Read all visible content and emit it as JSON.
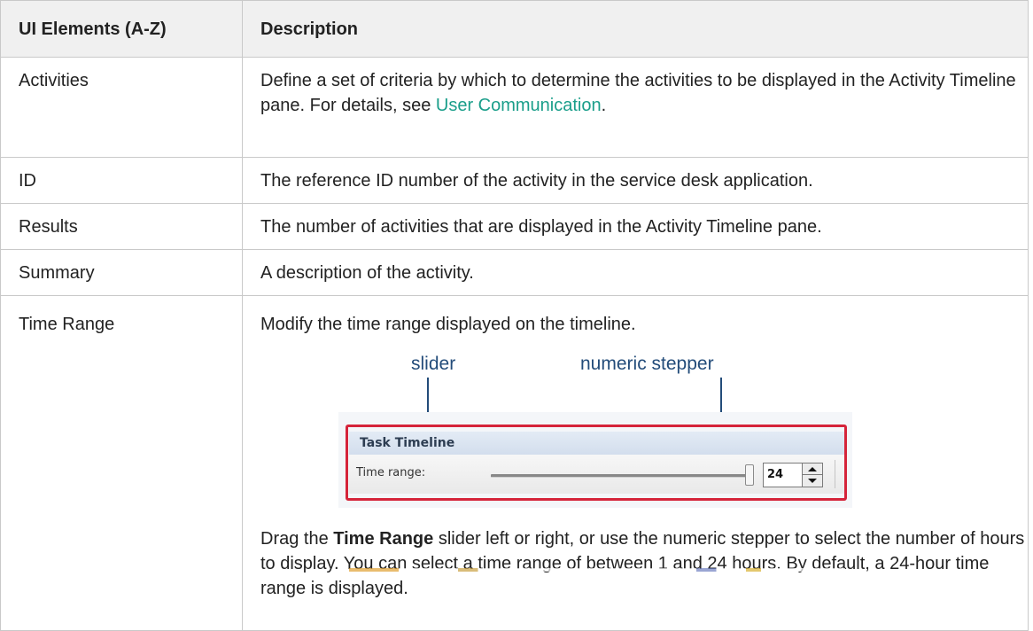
{
  "table": {
    "header": {
      "col1": "UI Elements (A-Z)",
      "col2": "Description"
    },
    "rows": [
      {
        "name": "Activities",
        "desc_before_link": "Define a set of criteria by which to determine the activities to be displayed in the Activity Timeline pane. For details, see ",
        "link": "User Communication",
        "desc_after_link": "."
      },
      {
        "name": "ID",
        "desc": "The reference ID number of the activity in the service desk application."
      },
      {
        "name": "Results",
        "desc": "The number of activities that are displayed in the Activity Timeline pane."
      },
      {
        "name": "Summary",
        "desc": "A description of the activity."
      },
      {
        "name": "Time Range",
        "desc": "Modify the time range displayed on the timeline.",
        "figure": {
          "callout_slider": "slider",
          "callout_stepper": "numeric stepper",
          "panel_title": "Task Timeline",
          "time_range_label": "Time range:",
          "stepper_value": "24",
          "slider_level": 1.0
        },
        "detail_1": "Drag the ",
        "detail_bold": "Time Range",
        "detail_2": " slider left or right, or use the numeric stepper to select the number of hours to display. You can select a time range of between 1 and 24 hours. By default, a 24-hour time range is displayed."
      }
    ]
  },
  "colors": {
    "link": "#1a9e8a",
    "highlight": "#d5243a",
    "callout": "#234c7a",
    "header_bg": "#f0f0f0"
  }
}
